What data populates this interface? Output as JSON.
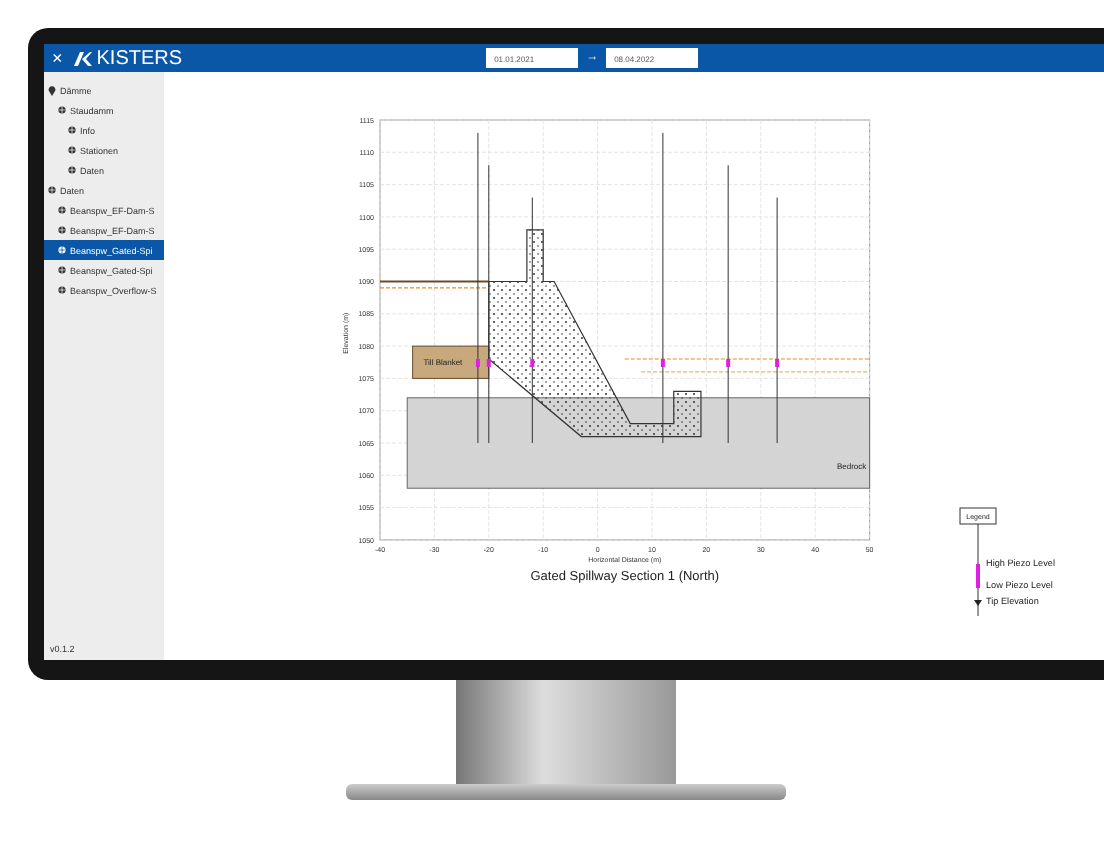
{
  "header": {
    "close": "×",
    "logo": "KISTERS",
    "date_from": "01.01.2021",
    "arrow": "→",
    "date_to": "08.04.2022"
  },
  "sidebar": {
    "tree": [
      {
        "label": "Dämme",
        "kind": "pin",
        "selected": false,
        "children": [
          {
            "label": "Staudamm",
            "kind": "globe",
            "selected": false,
            "children": [
              {
                "label": "Info",
                "kind": "globe",
                "selected": false
              },
              {
                "label": "Stationen",
                "kind": "globe",
                "selected": false
              },
              {
                "label": "Daten",
                "kind": "globe",
                "selected": false
              }
            ]
          }
        ]
      },
      {
        "label": "Daten",
        "kind": "globe",
        "selected": false,
        "children": [
          {
            "label": "Beanspw_EF-Dam-S",
            "kind": "globe",
            "selected": false
          },
          {
            "label": "Beanspw_EF-Dam-S",
            "kind": "globe",
            "selected": false
          },
          {
            "label": "Beanspw_Gated-Spi",
            "kind": "globe",
            "selected": true
          },
          {
            "label": "Beanspw_Gated-Spi",
            "kind": "globe",
            "selected": false
          },
          {
            "label": "Beanspw_Overflow-S",
            "kind": "globe",
            "selected": false
          }
        ]
      }
    ],
    "version": "v0.1.2"
  },
  "diagram": {
    "title": "Gated Spillway Section 1 (North)",
    "xlabel": "Horizontal Distance (m)",
    "ylabel": "Elevation (m)",
    "xticks": [
      "-40",
      "-30",
      "-20",
      "-10",
      "0",
      "10",
      "20",
      "30",
      "40",
      "50"
    ],
    "yticks": [
      "1115",
      "1110",
      "1105",
      "1100",
      "1095",
      "1090",
      "1085",
      "1080",
      "1075",
      "1070",
      "1065",
      "1060",
      "1055",
      "1050"
    ],
    "annotations": [
      "Till Blanket",
      "Bedrock"
    ],
    "legend": {
      "title": "Legend",
      "items": [
        "High Piezo Level",
        "Low Piezo Level",
        "Tip Elevation"
      ]
    }
  }
}
